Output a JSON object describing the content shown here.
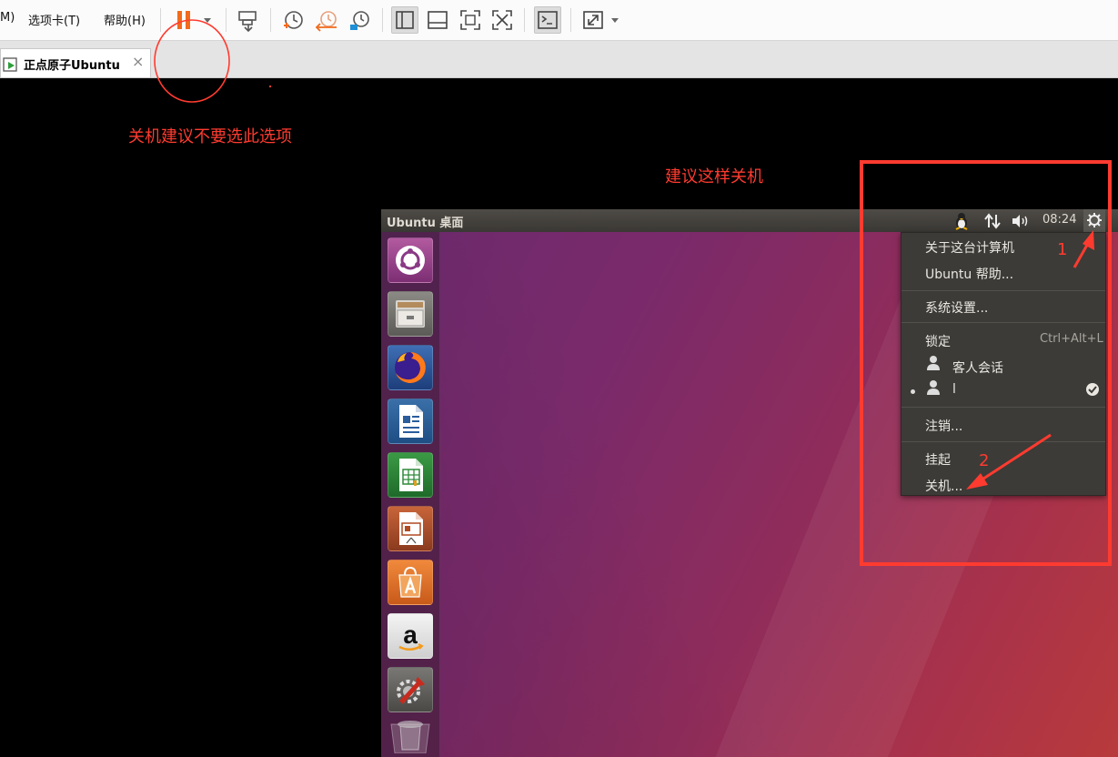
{
  "toolbar": {
    "menu_vm": "M)",
    "menu_tabs": "选项卡(T)",
    "menu_help": "帮助(H)"
  },
  "tab": {
    "label": "正点原子Ubuntu",
    "close": "×"
  },
  "annotations": {
    "warning": "关机建议不要选此选项",
    "recommend": "建议这样关机",
    "step1": "1",
    "step2": "2",
    "color": "#ff3b30"
  },
  "ubuntu": {
    "panel_title": "Ubuntu 桌面",
    "clock": "08:24",
    "launcher_icons": [
      "ubuntu-dash-icon",
      "files-icon",
      "firefox-icon",
      "libreoffice-writer-icon",
      "libreoffice-calc-icon",
      "libreoffice-impress-icon",
      "software-center-icon",
      "amazon-icon",
      "system-settings-icon",
      "trash-icon"
    ],
    "menu": {
      "about": "关于这台计算机",
      "help": "Ubuntu 帮助...",
      "settings": "系统设置...",
      "lock": "锁定",
      "lock_shortcut": "Ctrl+Alt+L",
      "guest": "客人会话",
      "user": "l",
      "logout": "注销...",
      "suspend": "挂起",
      "shutdown": "关机..."
    }
  }
}
